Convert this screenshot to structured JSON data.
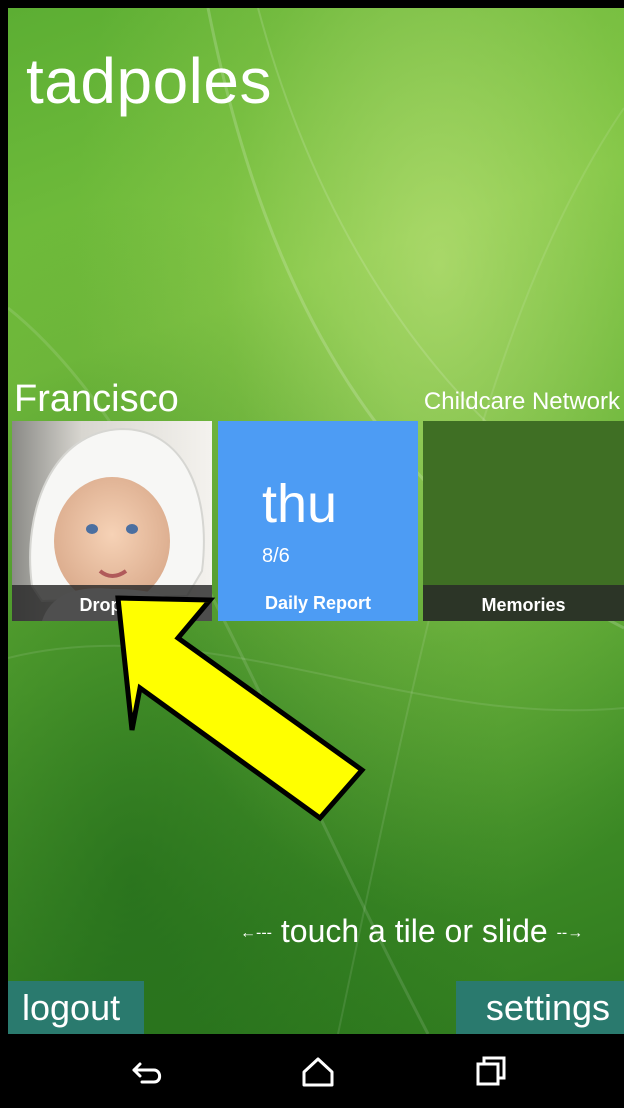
{
  "app": {
    "title": "tadpoles"
  },
  "header": {
    "child_name": "Francisco",
    "network": "Childcare Network"
  },
  "tiles": [
    {
      "label": "Dropoff",
      "icon": "child-photo"
    },
    {
      "day": "thu",
      "date": "8/6",
      "label": "Daily Report"
    },
    {
      "label": "Memories"
    }
  ],
  "hint": {
    "text": "touch a tile or slide",
    "left_arrow": "←---",
    "right_arrow": "--→"
  },
  "footer": {
    "logout": "logout",
    "settings": "settings"
  },
  "navbar": {
    "back_icon": "back-icon",
    "home_icon": "home-icon",
    "recents_icon": "recents-icon"
  },
  "colors": {
    "accent_blue": "#4d9cf4",
    "button_teal": "#2a7a6e",
    "background_green": "#5cae33",
    "annotation_yellow": "#ffff00"
  }
}
